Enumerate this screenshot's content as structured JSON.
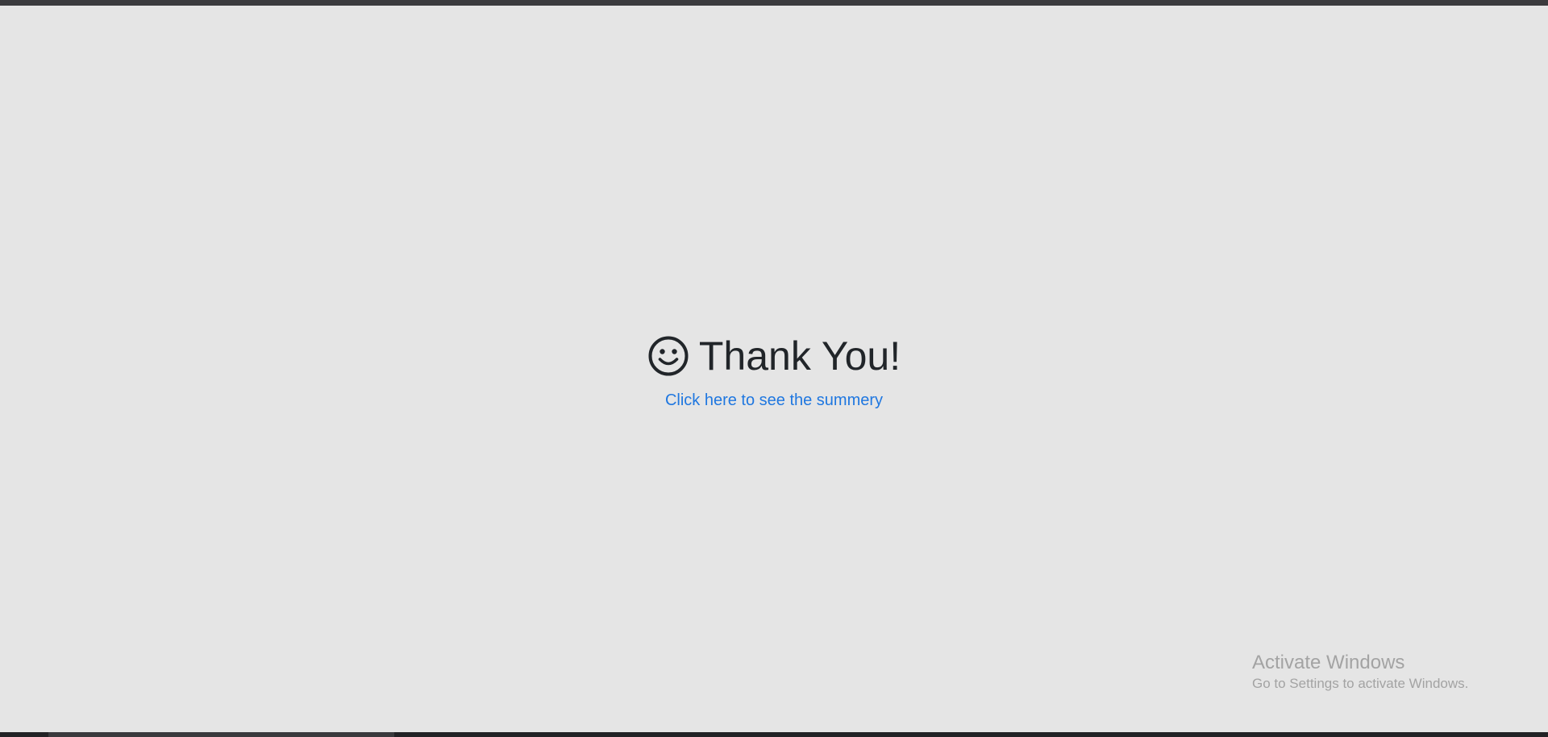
{
  "main": {
    "heading": "Thank You!",
    "icon": "smiley-face-icon",
    "summary_link": "Click here to see the summery"
  },
  "watermark": {
    "title": "Activate Windows",
    "subtitle": "Go to Settings to activate Windows."
  },
  "colors": {
    "background": "#e5e5e5",
    "heading": "#212529",
    "link": "#1f77e0",
    "watermark": "#a3a3a3"
  }
}
